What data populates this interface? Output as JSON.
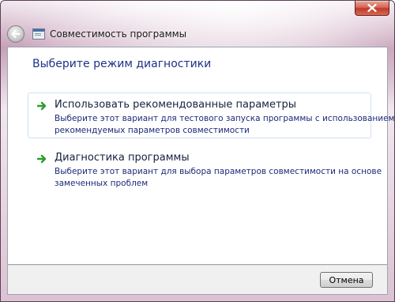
{
  "window": {
    "title": "Совместимость программы",
    "close_icon": "close-icon",
    "back_icon": "back-arrow-icon",
    "app_icon": "program-window-icon"
  },
  "main": {
    "heading": "Выберите режим диагностики",
    "options": [
      {
        "label": "Использовать рекомендованные параметры",
        "description_line1": "Выберите этот вариант для тестового запуска программы с использованием",
        "description_line2": "рекомендуемых параметров совместимости",
        "icon": "green-arrow-icon"
      },
      {
        "label": "Диагностика программы",
        "description_line1": "Выберите этот вариант для выбора параметров совместимости на основе",
        "description_line2": "замеченных проблем",
        "icon": "green-arrow-icon"
      }
    ]
  },
  "footer": {
    "cancel_label": "Отмена"
  },
  "colors": {
    "heading": "#1e3287",
    "option_label": "#15213d",
    "option_description": "#1c2a7a",
    "arrow": "#2e9b2e",
    "close_button": "#c0392b"
  }
}
